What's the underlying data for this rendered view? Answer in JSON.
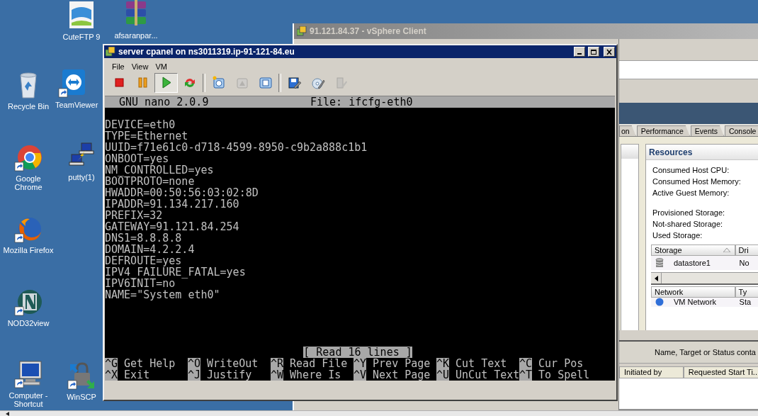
{
  "desktop_icons": [
    {
      "label": "CuteFTP 9",
      "kind": "cuteftp"
    },
    {
      "label": "afsaranpar...",
      "kind": "archive"
    },
    {
      "label": "Recycle Bin",
      "kind": "recycle"
    },
    {
      "label": "TeamViewer",
      "kind": "teamviewer"
    },
    {
      "label": "Google Chrome",
      "kind": "chrome"
    },
    {
      "label": "putty(1)",
      "kind": "putty"
    },
    {
      "label": "Mozilla Firefox",
      "kind": "firefox"
    },
    {
      "label": "NOD32view",
      "kind": "nod"
    },
    {
      "label": "Computer - Shortcut",
      "kind": "computer"
    },
    {
      "label": "WinSCP",
      "kind": "winscp"
    }
  ],
  "vsphere": {
    "title": "91.121.84.37 - vSphere Client",
    "tabs": [
      {
        "label": "on",
        "selected": false
      },
      {
        "label": "Performance",
        "selected": false
      },
      {
        "label": "Events",
        "selected": false
      },
      {
        "label": "Console",
        "selected": false
      }
    ],
    "resources": {
      "title": "Resources",
      "field_groups": [
        [
          "Consumed Host CPU:",
          "Consumed Host Memory:",
          "Active Guest Memory:"
        ],
        [
          "Provisioned Storage:",
          "Not-shared Storage:",
          "Used Storage:"
        ]
      ],
      "storage_table": {
        "columns": [
          "Storage",
          "Dri"
        ],
        "rows": [
          [
            "datastore1",
            "No"
          ]
        ]
      },
      "network_table": {
        "columns": [
          "Network",
          "Ty"
        ],
        "rows": [
          [
            "VM Network",
            "Sta"
          ]
        ]
      }
    },
    "filter_text": "Name, Target or Status conta",
    "task_columns": [
      "Initiated by",
      "Requested Start Ti..."
    ]
  },
  "console": {
    "title": "server cpanel on ns3011319.ip-91-121-84.eu",
    "menu": [
      "File",
      "View",
      "VM"
    ],
    "toolbar": [
      {
        "kind": "stop",
        "pressed": false,
        "disabled": false
      },
      {
        "kind": "pause",
        "pressed": false,
        "disabled": false
      },
      {
        "kind": "play",
        "pressed": true,
        "disabled": false
      },
      {
        "kind": "reset",
        "pressed": false,
        "disabled": false
      },
      {
        "kind": "separator"
      },
      {
        "kind": "snapshot",
        "pressed": false,
        "disabled": false
      },
      {
        "kind": "revert",
        "pressed": false,
        "disabled": true
      },
      {
        "kind": "manage",
        "pressed": false,
        "disabled": false
      },
      {
        "kind": "separator"
      },
      {
        "kind": "settings",
        "pressed": false,
        "disabled": false
      },
      {
        "kind": "cd",
        "pressed": false,
        "disabled": false
      },
      {
        "kind": "usb",
        "pressed": false,
        "disabled": true
      }
    ],
    "nano": {
      "header_left": "GNU nano 2.0.9",
      "header_right": "File: ifcfg-eth0",
      "lines": [
        "DEVICE=eth0",
        "TYPE=Ethernet",
        "UUID=f71e61c0-d718-4599-8950-c9b2a888c1b1",
        "ONBOOT=yes",
        "NM_CONTROLLED=yes",
        "BOOTPROTO=none",
        "HWADDR=00:50:56:03:02:8D",
        "IPADDR=91.134.217.160",
        "PREFIX=32",
        "GATEWAY=91.121.84.254",
        "DNS1=8.8.8.8",
        "DOMAIN=4.2.2.4",
        "DEFROUTE=yes",
        "IPV4_FAILURE_FATAL=yes",
        "IPV6INIT=no",
        "NAME=\"System eth0\""
      ],
      "status": "[ Read 16 lines ]",
      "shortcut_rows": [
        [
          {
            "key": "^G",
            "label": "Get Help"
          },
          {
            "key": "^O",
            "label": "WriteOut"
          },
          {
            "key": "^R",
            "label": "Read File"
          },
          {
            "key": "^Y",
            "label": "Prev Page"
          },
          {
            "key": "^K",
            "label": "Cut Text"
          },
          {
            "key": "^C",
            "label": "Cur Pos"
          }
        ],
        [
          {
            "key": "^X",
            "label": "Exit"
          },
          {
            "key": "^J",
            "label": "Justify"
          },
          {
            "key": "^W",
            "label": "Where Is"
          },
          {
            "key": "^V",
            "label": "Next Page"
          },
          {
            "key": "^U",
            "label": "UnCut Text"
          },
          {
            "key": "^T",
            "label": "To Spell"
          }
        ]
      ]
    }
  }
}
